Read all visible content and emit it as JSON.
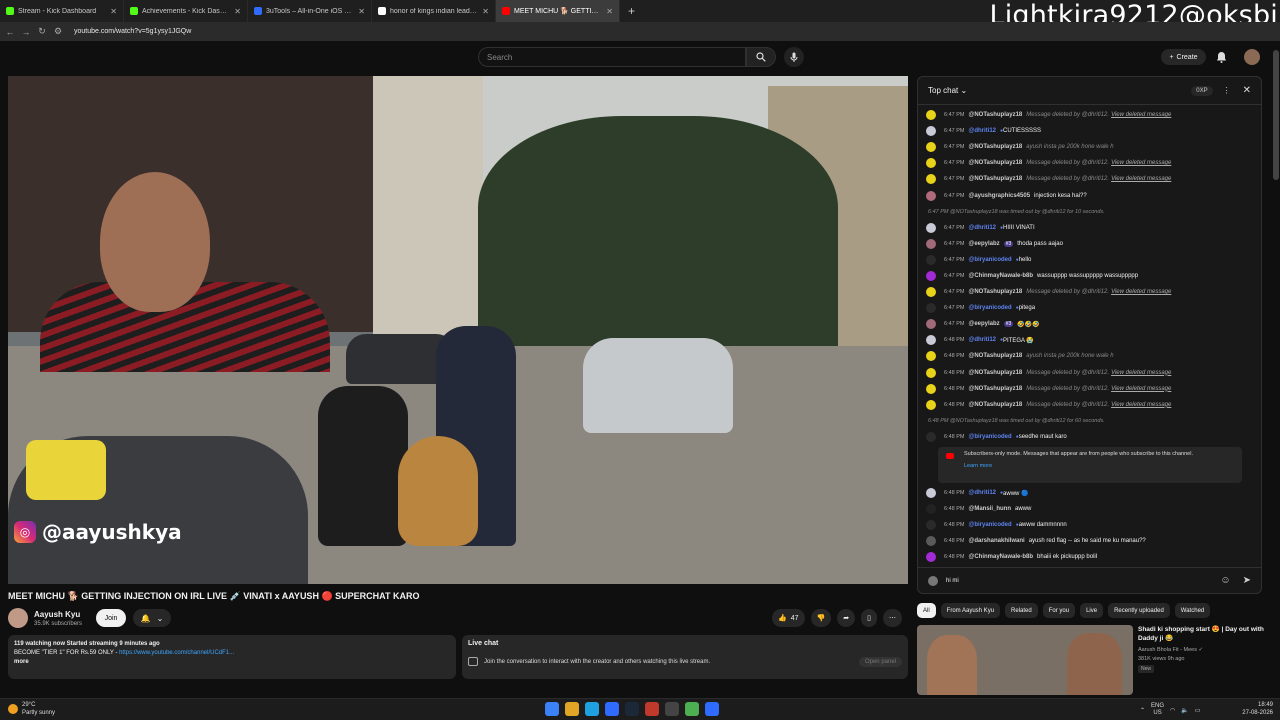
{
  "browser": {
    "tabs": [
      {
        "label": "Stream - Kick Dashboard",
        "color": "#53fc18"
      },
      {
        "label": "Achievements - Kick Dashboard",
        "color": "#53fc18"
      },
      {
        "label": "3uTools – All-in-One iOS Device",
        "color": "#2f6bff"
      },
      {
        "label": "honor of kings indian leaderbo",
        "color": "#ffffff"
      },
      {
        "label": "MEET MICHU 🐕 GETTING I",
        "color": "#ff0000"
      }
    ],
    "url": "youtube.com/watch?v=5g1ysy1JGQw",
    "overlay_text": "Lightkira9212@oksbi"
  },
  "youtube": {
    "search_placeholder": "Search",
    "create_label": "Create"
  },
  "video": {
    "instagram_handle": "@aayushkya",
    "title": "MEET MICHU 🐕 GETTING INJECTION ON IRL LIVE 💉 VINATI x AAYUSH 🔴 SUPERCHAT KARO",
    "channel": "Aayush Kyu",
    "subscribers": "35.9K subscribers",
    "join_label": "Join",
    "likes": "47",
    "desc_line1": "119 watching now  Started streaming 9 minutes ago",
    "desc_line2": "BECOME \"TIER 1\" FOR Rs.59 ONLY - ",
    "desc_link": "https://www.youtube.com/channel/UCdF1...",
    "desc_more": "more"
  },
  "livechat_box": {
    "heading": "Live chat",
    "message": "Join the conversation to interact with the creator and others watching this live stream.",
    "open_panel": "Open panel"
  },
  "chat": {
    "header": "Top chat",
    "xp": "0XP",
    "messages": [
      {
        "time": "6:47 PM",
        "name": "@NOTashuplayz18",
        "text": "Message deleted by @dhriti12.",
        "deleted": true,
        "color": "#e8d21a"
      },
      {
        "time": "6:47 PM",
        "name": "@dhriti12",
        "text": "CUTIESSSSS",
        "mod": true,
        "color": "#c9c9d8"
      },
      {
        "time": "6:47 PM",
        "name": "@NOTashuplayz18",
        "text": "ayush insta pe 200k hone wale h",
        "deleted": true,
        "color": "#e8d21a"
      },
      {
        "time": "6:47 PM",
        "name": "@NOTashuplayz18",
        "text": "Message deleted by @dhriti12.",
        "deleted": true,
        "color": "#e8d21a"
      },
      {
        "time": "6:47 PM",
        "name": "@NOTashuplayz18",
        "text": "Message deleted by @dhriti12.",
        "deleted": true,
        "color": "#e8d21a"
      },
      {
        "time": "6:47 PM",
        "name": "@ayushgraphics4505",
        "text": "injection kesa hai??",
        "color": "#b06a7a"
      },
      {
        "system": true,
        "text": "6:47 PM  @NOTashuplayz18 was timed out by @dhriti12 for 10 seconds."
      },
      {
        "time": "6:47 PM",
        "name": "@dhriti12",
        "text": "HIIII VINATI",
        "mod": true,
        "color": "#c9c9d8"
      },
      {
        "time": "6:47 PM",
        "name": "@eepylabz",
        "badge": "#3",
        "text": "thoda pass aajao",
        "color": "#a06a7a"
      },
      {
        "time": "6:47 PM",
        "name": "@biryanicoded",
        "text": "hello",
        "mod": true,
        "color": "#2a2a2a"
      },
      {
        "time": "6:47 PM",
        "name": "@ChinmayNawale-b8b",
        "text": "wassupppp wassuppppp wassuppppp",
        "color": "#a22bd6"
      },
      {
        "time": "6:47 PM",
        "name": "@NOTashuplayz18",
        "text": "Message deleted by @dhriti12.",
        "deleted": true,
        "color": "#e8d21a"
      },
      {
        "time": "6:47 PM",
        "name": "@biryanicoded",
        "text": "pitega",
        "mod": true,
        "color": "#2a2a2a"
      },
      {
        "time": "6:47 PM",
        "name": "@eepylabz",
        "badge": "#3",
        "text": "🤣🤣🤣",
        "color": "#a06a7a"
      },
      {
        "time": "6:48 PM",
        "name": "@dhriti12",
        "text": "PITEGA 😭",
        "mod": true,
        "color": "#c9c9d8"
      },
      {
        "time": "6:48 PM",
        "name": "@NOTashuplayz18",
        "text": "ayush insta pe 200k hone wale h",
        "deleted": true,
        "color": "#e8d21a"
      },
      {
        "time": "6:48 PM",
        "name": "@NOTashuplayz18",
        "text": "Message deleted by @dhriti12.",
        "deleted": true,
        "color": "#e8d21a"
      },
      {
        "time": "6:48 PM",
        "name": "@NOTashuplayz18",
        "text": "Message deleted by @dhriti12.",
        "deleted": true,
        "color": "#e8d21a"
      },
      {
        "time": "6:48 PM",
        "name": "@NOTashuplayz18",
        "text": "Message deleted by @dhriti12.",
        "deleted": true,
        "color": "#e8d21a"
      },
      {
        "system": true,
        "text": "6:48 PM  @NOTashuplayz18 was timed out by @dhriti12 for 60 seconds."
      },
      {
        "time": "6:48 PM",
        "name": "@biryanicoded",
        "text": "seedhe maut karo",
        "mod": true,
        "color": "#2a2a2a"
      }
    ],
    "view_deleted": "View deleted message",
    "submode_text": "Subscribers-only mode. Messages that appear are from people who subscribe to this channel.",
    "learn_more": "Learn more",
    "messages2": [
      {
        "time": "6:48 PM",
        "name": "@dhriti12",
        "text": "awww 🔵",
        "mod": true,
        "color": "#c9c9d8"
      },
      {
        "time": "6:48 PM",
        "name": "@Mansii_hunn",
        "text": "awww",
        "color": "#222222"
      },
      {
        "time": "6:48 PM",
        "name": "@biryanicoded",
        "text": "awww dammnnnn",
        "mod": true,
        "color": "#2a2a2a"
      },
      {
        "time": "6:48 PM",
        "name": "@darshanakhilwani",
        "text": "ayush red flag -- as he said me ku manau??",
        "color": "#5a5a5a"
      },
      {
        "time": "6:48 PM",
        "name": "@ChinmayNawale-b8b",
        "text": "bhaiii ek pickuppp boliI",
        "color": "#a22bd6"
      }
    ],
    "input_value": "hi mi"
  },
  "related": {
    "chips": [
      "All",
      "From Aayush Kyu",
      "Related",
      "For you",
      "Live",
      "Recently uploaded",
      "Watched"
    ],
    "video_title": "Shadi ki shopping start 😍 | Day out with Daddy ji 😂",
    "video_channel": "Aarush Bhola Fit - Mees ✓",
    "video_meta": "381K views  9h ago",
    "video_badge": "New"
  },
  "taskbar": {
    "temp": "29°C",
    "weather": "Partly sunny",
    "lang1": "ENG",
    "lang2": "US",
    "time": "18:49",
    "date": "27-08-2026"
  }
}
